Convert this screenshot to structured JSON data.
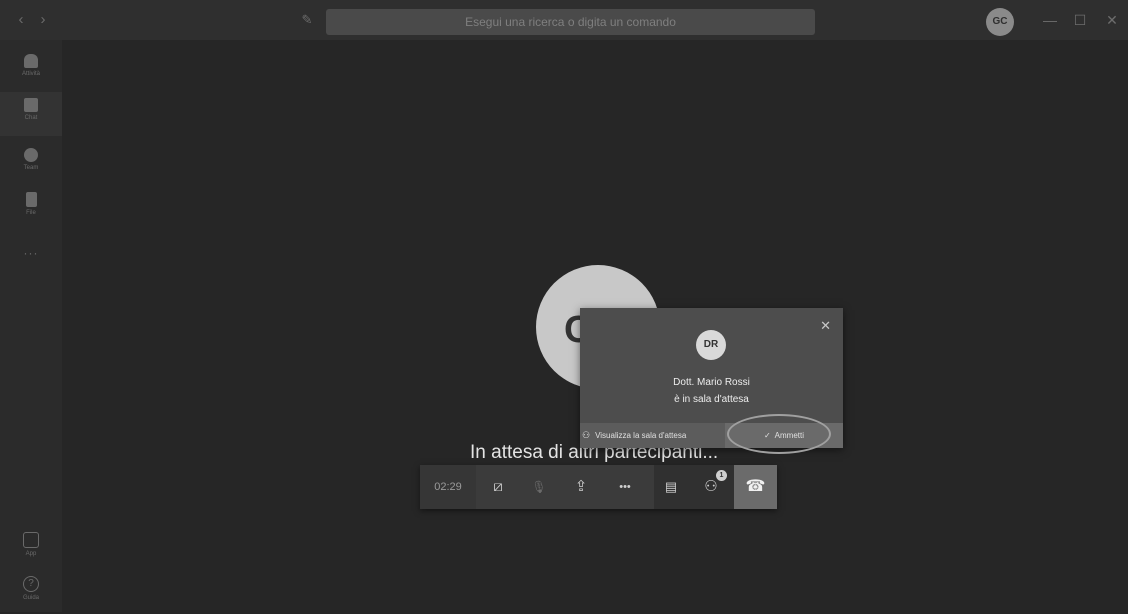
{
  "topbar": {
    "back_icon": "‹",
    "forward_icon": "›",
    "search_placeholder": "Esegui una ricerca o digita un comando",
    "user_initials": "GC",
    "minimize": "—",
    "maximize": "☐",
    "close": "✕"
  },
  "rail": {
    "items": [
      {
        "label": "Attività",
        "icon": "bell-icon"
      },
      {
        "label": "Chat",
        "icon": "chat-icon"
      },
      {
        "label": "Team",
        "icon": "teams-icon"
      },
      {
        "label": "File",
        "icon": "file-icon"
      }
    ],
    "more": "···",
    "apps_label": "App",
    "help_label": "Guida",
    "help_symbol": "?"
  },
  "stage": {
    "avatar_letter": "C",
    "waiting_text": "In attesa di altri partecipanti..."
  },
  "lobby_popup": {
    "close_icon": "✕",
    "avatar_initials": "DR",
    "name": "Dott. Mario Rossi",
    "status": "è in sala d'attesa",
    "view_lobby_label": "Visualizza la sala d'attesa",
    "admit_label": "Ammetti"
  },
  "controls": {
    "timer": "02:29",
    "camera_icon": "⧄",
    "mic_icon": "🎙",
    "share_icon": "⇪",
    "more_icon": "•••",
    "chat_icon": "▤",
    "participants_icon": "⚇",
    "participants_badge": "1",
    "hangup_icon": "☎"
  },
  "colors": {
    "background": "#262626",
    "topbar": "#2f2f2f",
    "popup": "#4d4d4d"
  }
}
